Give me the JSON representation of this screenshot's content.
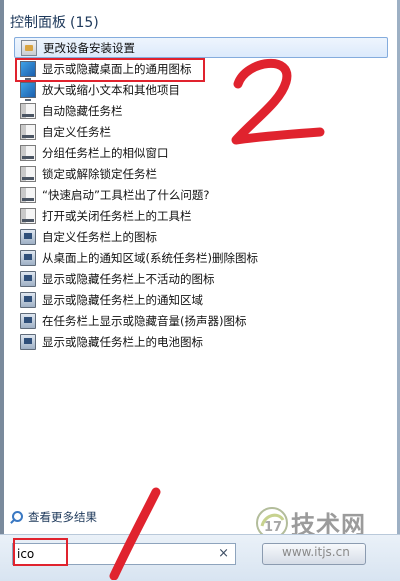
{
  "panel": {
    "title": "控制面板",
    "count": "(15)"
  },
  "items": [
    {
      "label": "更改设备安装设置",
      "icon": "device-settings-icon"
    },
    {
      "label": "显示或隐藏桌面上的通用图标",
      "icon": "monitor-icon"
    },
    {
      "label": "放大或缩小文本和其他项目",
      "icon": "monitor-icon"
    },
    {
      "label": "自动隐藏任务栏",
      "icon": "taskbar-icon"
    },
    {
      "label": "自定义任务栏",
      "icon": "taskbar-icon"
    },
    {
      "label": "分组任务栏上的相似窗口",
      "icon": "taskbar-icon"
    },
    {
      "label": "锁定或解除锁定任务栏",
      "icon": "taskbar-icon"
    },
    {
      "label": "“快速启动”工具栏出了什么问题?",
      "icon": "taskbar-icon"
    },
    {
      "label": "打开或关闭任务栏上的工具栏",
      "icon": "taskbar-icon"
    },
    {
      "label": "自定义任务栏上的图标",
      "icon": "notification-area-icon"
    },
    {
      "label": "从桌面上的通知区域(系统任务栏)删除图标",
      "icon": "notification-area-icon"
    },
    {
      "label": "显示或隐藏任务栏上不活动的图标",
      "icon": "notification-area-icon"
    },
    {
      "label": "显示或隐藏任务栏上的通知区域",
      "icon": "notification-area-icon"
    },
    {
      "label": "在任务栏上显示或隐藏音量(扬声器)图标",
      "icon": "notification-area-icon"
    },
    {
      "label": "显示或隐藏任务栏上的电池图标",
      "icon": "notification-area-icon"
    }
  ],
  "more_results": "查看更多结果",
  "search": {
    "value": "ico",
    "clear": "×"
  },
  "annotations": {
    "step_one": "1",
    "step_two": "2",
    "color": "#e0232e"
  },
  "watermark": {
    "logo_number": "17",
    "site_name": "技术网",
    "url": "www.itjs.cn"
  }
}
